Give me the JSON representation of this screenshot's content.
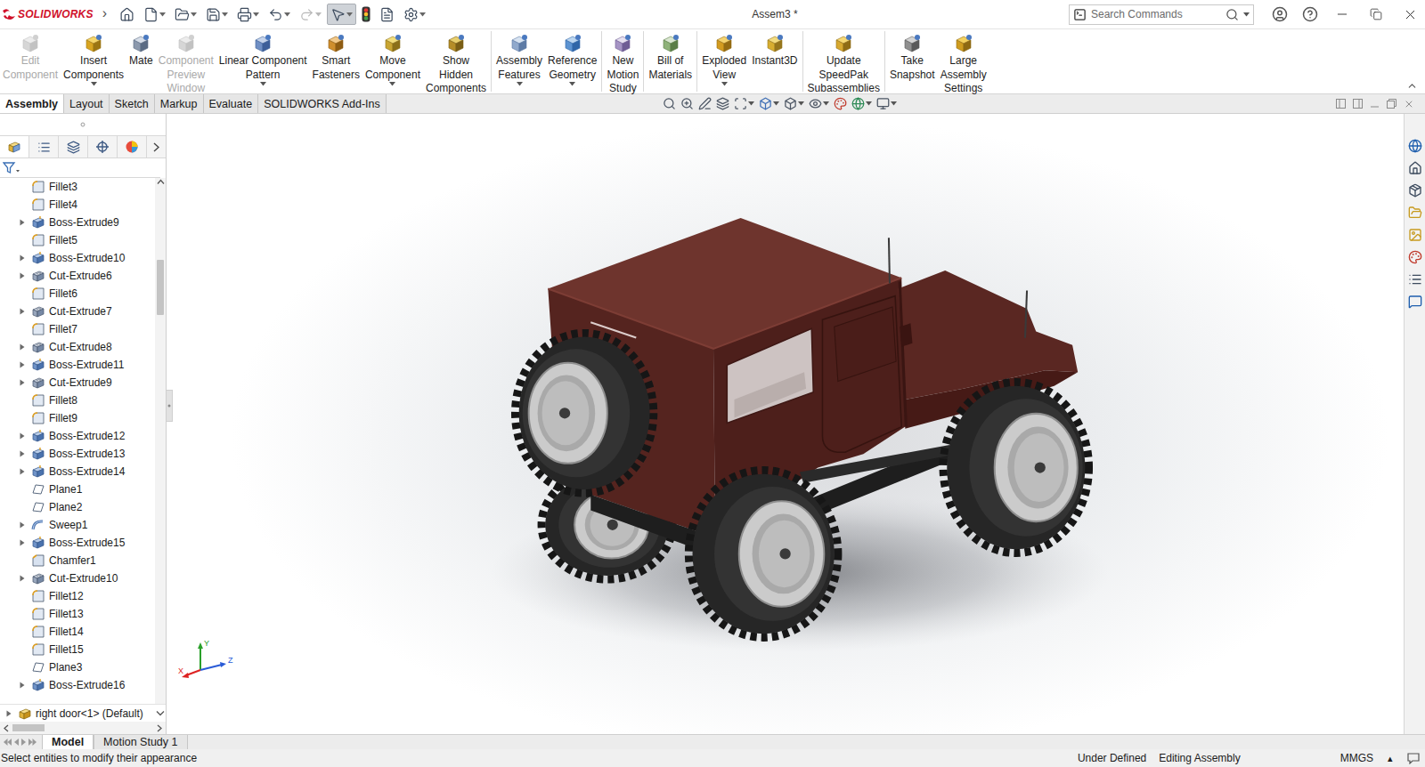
{
  "window": {
    "title": "Assem3 *",
    "app": "SOLIDWORKS",
    "menu_arrow": "›"
  },
  "quick_access": [
    {
      "kind": "home",
      "dropdown": false,
      "active": false,
      "disabled": false
    },
    {
      "kind": "new",
      "dropdown": true,
      "active": false,
      "disabled": false
    },
    {
      "kind": "open",
      "dropdown": true,
      "active": false,
      "disabled": false
    },
    {
      "kind": "save",
      "dropdown": true,
      "active": false,
      "disabled": false
    },
    {
      "kind": "print",
      "dropdown": true,
      "active": false,
      "disabled": false
    },
    {
      "kind": "undo",
      "dropdown": true,
      "active": false,
      "disabled": false
    },
    {
      "kind": "redo",
      "dropdown": true,
      "active": false,
      "disabled": true
    },
    {
      "kind": "select",
      "dropdown": true,
      "active": true,
      "disabled": false
    },
    {
      "kind": "rebuild",
      "dropdown": false,
      "active": false,
      "disabled": false
    },
    {
      "kind": "properties",
      "dropdown": false,
      "active": false,
      "disabled": false
    },
    {
      "kind": "options",
      "dropdown": true,
      "active": false,
      "disabled": false
    }
  ],
  "search": {
    "placeholder": "Search Commands"
  },
  "ribbon": [
    {
      "lines": [
        "Edit",
        "Component"
      ],
      "disabled": true,
      "dropdown": false,
      "group": 1
    },
    {
      "lines": [
        "Insert",
        "Components"
      ],
      "disabled": false,
      "dropdown": true,
      "group": 1
    },
    {
      "lines": [
        "Mate"
      ],
      "disabled": false,
      "dropdown": false,
      "group": 1
    },
    {
      "lines": [
        "Component",
        "Preview",
        "Window"
      ],
      "disabled": true,
      "dropdown": false,
      "group": 1
    },
    {
      "lines": [
        "Linear Component",
        "Pattern"
      ],
      "disabled": false,
      "dropdown": true,
      "group": 1
    },
    {
      "lines": [
        "Smart",
        "Fasteners"
      ],
      "disabled": false,
      "dropdown": false,
      "group": 1
    },
    {
      "lines": [
        "Move",
        "Component"
      ],
      "disabled": false,
      "dropdown": true,
      "group": 1
    },
    {
      "lines": [
        "Show",
        "Hidden",
        "Components"
      ],
      "disabled": false,
      "dropdown": false,
      "group": 1
    },
    {
      "lines": [
        "Assembly",
        "Features"
      ],
      "disabled": false,
      "dropdown": true,
      "group": 2
    },
    {
      "lines": [
        "Reference",
        "Geometry"
      ],
      "disabled": false,
      "dropdown": true,
      "group": 2
    },
    {
      "lines": [
        "New",
        "Motion",
        "Study"
      ],
      "disabled": false,
      "dropdown": false,
      "group": 3
    },
    {
      "lines": [
        "Bill of",
        "Materials"
      ],
      "disabled": false,
      "dropdown": false,
      "group": 4
    },
    {
      "lines": [
        "Exploded",
        "View"
      ],
      "disabled": false,
      "dropdown": true,
      "group": 5
    },
    {
      "lines": [
        "Instant3D"
      ],
      "disabled": false,
      "dropdown": false,
      "group": 5
    },
    {
      "lines": [
        "Update",
        "SpeedPak",
        "Subassemblies"
      ],
      "disabled": false,
      "dropdown": false,
      "group": 6
    },
    {
      "lines": [
        "Take",
        "Snapshot"
      ],
      "disabled": false,
      "dropdown": false,
      "group": 7
    },
    {
      "lines": [
        "Large",
        "Assembly",
        "Settings"
      ],
      "disabled": false,
      "dropdown": false,
      "group": 7
    }
  ],
  "command_tabs": [
    {
      "label": "Assembly",
      "selected": true
    },
    {
      "label": "Layout",
      "selected": false
    },
    {
      "label": "Sketch",
      "selected": false
    },
    {
      "label": "Markup",
      "selected": false
    },
    {
      "label": "Evaluate",
      "selected": false
    },
    {
      "label": "SOLIDWORKS Add-Ins",
      "selected": false
    }
  ],
  "feature_tree": {
    "scroll_level": 0.16,
    "items": [
      {
        "label": "Fillet3",
        "kind": "fillet",
        "expandable": false
      },
      {
        "label": "Fillet4",
        "kind": "fillet",
        "expandable": false
      },
      {
        "label": "Boss-Extrude9",
        "kind": "boss",
        "expandable": true
      },
      {
        "label": "Fillet5",
        "kind": "fillet",
        "expandable": false
      },
      {
        "label": "Boss-Extrude10",
        "kind": "boss",
        "expandable": true
      },
      {
        "label": "Cut-Extrude6",
        "kind": "cut",
        "expandable": true
      },
      {
        "label": "Fillet6",
        "kind": "fillet",
        "expandable": false
      },
      {
        "label": "Cut-Extrude7",
        "kind": "cut",
        "expandable": true
      },
      {
        "label": "Fillet7",
        "kind": "fillet",
        "expandable": false
      },
      {
        "label": "Cut-Extrude8",
        "kind": "cut",
        "expandable": true
      },
      {
        "label": "Boss-Extrude11",
        "kind": "boss",
        "expandable": true
      },
      {
        "label": "Cut-Extrude9",
        "kind": "cut",
        "expandable": true
      },
      {
        "label": "Fillet8",
        "kind": "fillet",
        "expandable": false
      },
      {
        "label": "Fillet9",
        "kind": "fillet",
        "expandable": false
      },
      {
        "label": "Boss-Extrude12",
        "kind": "boss",
        "expandable": true
      },
      {
        "label": "Boss-Extrude13",
        "kind": "boss",
        "expandable": true
      },
      {
        "label": "Boss-Extrude14",
        "kind": "boss",
        "expandable": true
      },
      {
        "label": "Plane1",
        "kind": "plane",
        "expandable": false
      },
      {
        "label": "Plane2",
        "kind": "plane",
        "expandable": false
      },
      {
        "label": "Sweep1",
        "kind": "sweep",
        "expandable": true
      },
      {
        "label": "Boss-Extrude15",
        "kind": "boss",
        "expandable": true
      },
      {
        "label": "Chamfer1",
        "kind": "chamfer",
        "expandable": false
      },
      {
        "label": "Cut-Extrude10",
        "kind": "cut",
        "expandable": true
      },
      {
        "label": "Fillet12",
        "kind": "fillet",
        "expandable": false
      },
      {
        "label": "Fillet13",
        "kind": "fillet",
        "expandable": false
      },
      {
        "label": "Fillet14",
        "kind": "fillet",
        "expandable": false
      },
      {
        "label": "Fillet15",
        "kind": "fillet",
        "expandable": false
      },
      {
        "label": "Plane3",
        "kind": "plane",
        "expandable": false
      },
      {
        "label": "Boss-Extrude16",
        "kind": "boss",
        "expandable": true
      }
    ],
    "component": {
      "label": "right door<1> (Default)",
      "expandable": true
    }
  },
  "triad": {
    "labels": [
      "Y",
      "X",
      "Z"
    ]
  },
  "bottom_tabs": [
    {
      "label": "Model",
      "selected": true
    },
    {
      "label": "Motion Study 1",
      "selected": false
    }
  ],
  "status_bar": {
    "message": "Select entities to modify their appearance",
    "fields": [
      "Under Defined",
      "Editing Assembly",
      "MMGS"
    ],
    "units_arrow": "▴"
  }
}
